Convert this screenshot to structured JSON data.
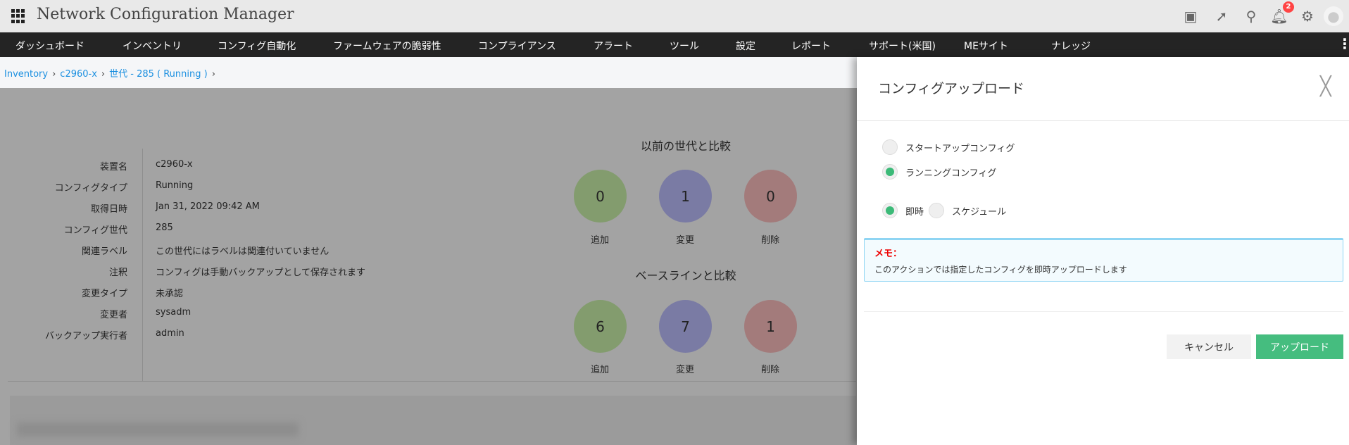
{
  "app": {
    "title": "Network Configuration Manager",
    "notification_count": "2"
  },
  "nav": [
    "ダッシュボード",
    "インベントリ",
    "コンフィグ自動化",
    "ファームウェアの脆弱性",
    "コンプライアンス",
    "アラート",
    "ツール",
    "設定",
    "レポート",
    "サポート(米国)",
    "MEサイト",
    "ナレッジ"
  ],
  "breadcrumb": [
    "Inventory",
    "c2960-x",
    "世代 - 285 ( Running )"
  ],
  "details": [
    {
      "label": "装置名",
      "value": "c2960-x"
    },
    {
      "label": "コンフィグタイプ",
      "value": "Running"
    },
    {
      "label": "取得日時",
      "value": "Jan 31, 2022 09:42 AM"
    },
    {
      "label": "コンフィグ世代",
      "value": "285"
    },
    {
      "label": "関連ラベル",
      "value": "この世代にはラベルは関連付いていません"
    },
    {
      "label": "注釈",
      "value": "コンフィグは手動バックアップとして保存されます"
    },
    {
      "label": "変更タイプ",
      "value": "未承認"
    },
    {
      "label": "変更者",
      "value": "sysadm"
    },
    {
      "label": "バックアップ実行者",
      "value": "admin"
    }
  ],
  "compare_previous": {
    "title": "以前の世代と比較",
    "added": "0",
    "changed": "1",
    "deleted": "0"
  },
  "compare_baseline": {
    "title": "ベースラインと比較",
    "added": "6",
    "changed": "7",
    "deleted": "1"
  },
  "labels": {
    "added": "追加",
    "changed": "変更",
    "deleted": "削除"
  },
  "colors": {
    "added": "#839c6e",
    "changed": "#7a7ba4",
    "deleted": "#a37b7b",
    "accent": "#45bd7f"
  },
  "panel": {
    "title": "コンフィグアップロード",
    "config_options": [
      {
        "label": "スタートアップコンフィグ",
        "selected": false
      },
      {
        "label": "ランニングコンフィグ",
        "selected": true
      }
    ],
    "timing_options": [
      {
        "label": "即時",
        "selected": true
      },
      {
        "label": "スケジュール",
        "selected": false
      }
    ],
    "memo_title": "メモ：",
    "memo_text": "このアクションでは指定したコンフィグを即時アップロードします",
    "cancel": "キャンセル",
    "upload": "アップロード"
  }
}
